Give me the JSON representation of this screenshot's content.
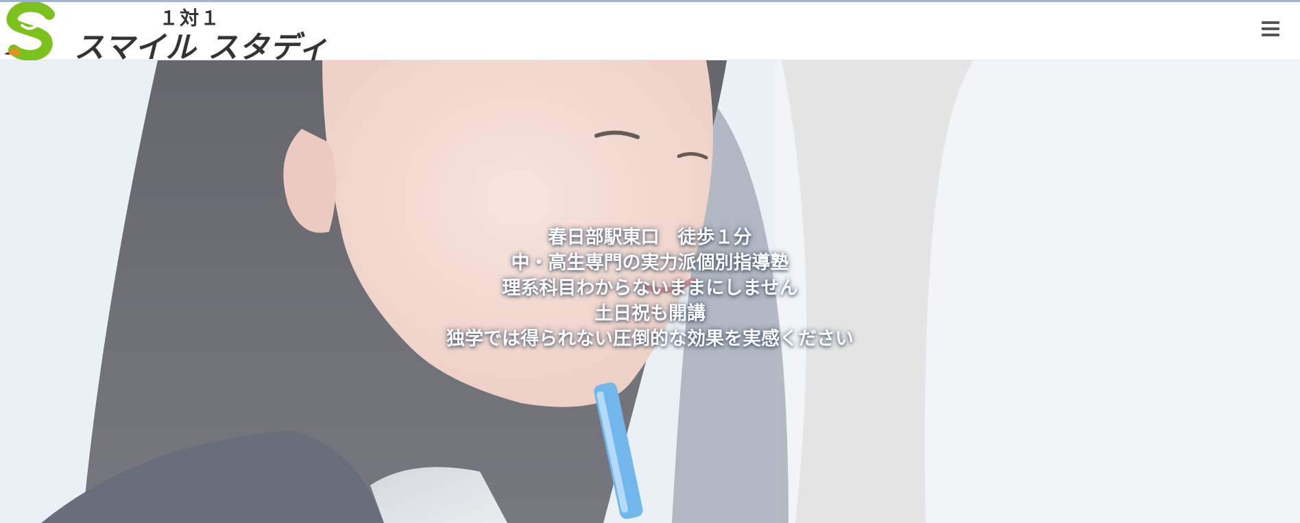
{
  "header": {
    "logo": {
      "sub": "１対１",
      "main": "スマイル スタディ"
    },
    "menu_icon": "hamburger-menu-icon"
  },
  "hero": {
    "lines": [
      "春日部駅東口　徒歩１分",
      "中・高生専門の実力派個別指導塾",
      "理系科目わからないままにしません",
      "土日祝も開講",
      "独学では得られない圧倒的な効果を実感ください"
    ]
  },
  "colors": {
    "logo_green": "#7cc21c",
    "logo_orange": "#f08a24",
    "text_dark": "#333333",
    "hero_text": "#ffffff"
  }
}
